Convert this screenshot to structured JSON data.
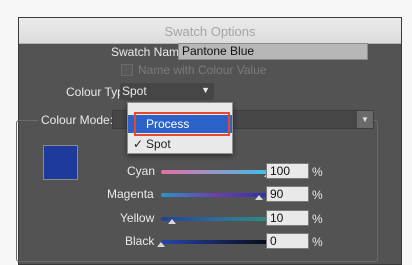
{
  "window": {
    "title": "Swatch Options"
  },
  "swatch_name": {
    "label": "Swatch Name:",
    "value": "Pantone Blue"
  },
  "name_with_value": {
    "label": "Name with Colour Value",
    "checked": false,
    "enabled": false
  },
  "colour_type": {
    "label": "Colour Type:",
    "value": "Spot",
    "options": [
      {
        "label": "Process",
        "checked": false,
        "hovered": true
      },
      {
        "label": "Spot",
        "checked": true,
        "hovered": false
      }
    ],
    "checkmark": "✓"
  },
  "colour_mode": {
    "label": "Colour Mode:"
  },
  "swatch_color": "#1e3a9a",
  "menu_highlight_color": "#2c63c9",
  "annotation_color": "#e8492a",
  "sliders": [
    {
      "label": "Cyan",
      "value": "100",
      "unit": "%"
    },
    {
      "label": "Magenta",
      "value": "90",
      "unit": "%"
    },
    {
      "label": "Yellow",
      "value": "10",
      "unit": "%"
    },
    {
      "label": "Black",
      "value": "0",
      "unit": "%"
    }
  ]
}
